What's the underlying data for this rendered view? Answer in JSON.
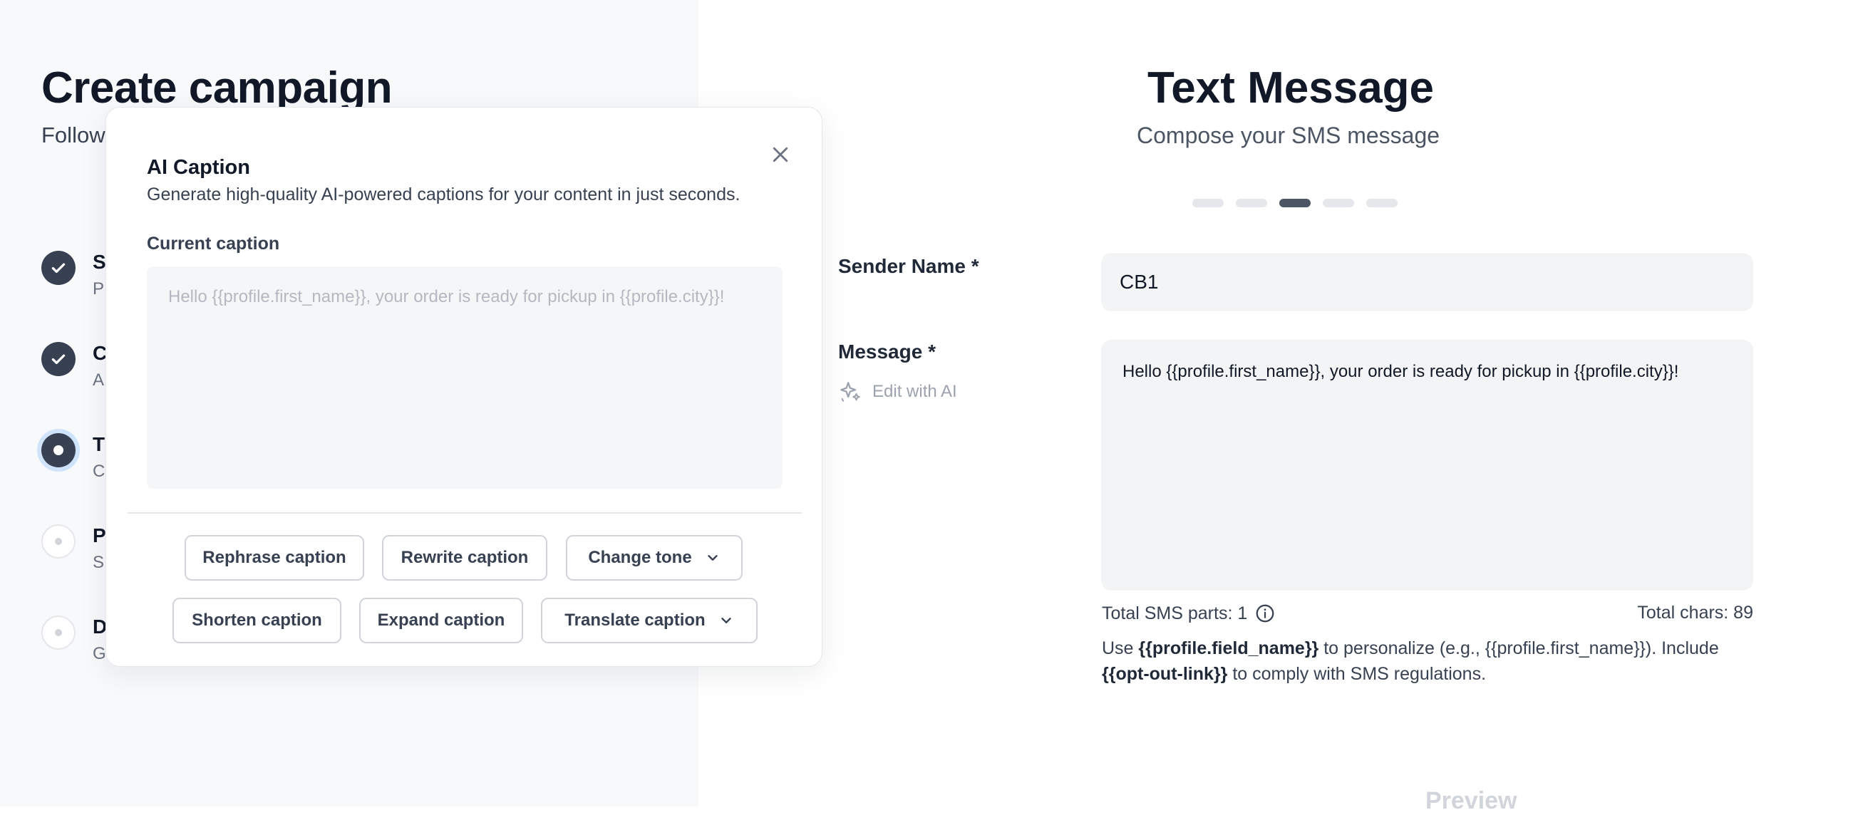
{
  "campaign": {
    "title": "Create campaign",
    "subtitle": "Follow",
    "steps": [
      {
        "title": "S",
        "desc": "P",
        "state": "done"
      },
      {
        "title": "C",
        "desc": "A",
        "state": "done"
      },
      {
        "title": "T",
        "desc": "C",
        "state": "current"
      },
      {
        "title": "P",
        "desc": "S",
        "state": "upcoming"
      },
      {
        "title": "D",
        "desc": "G",
        "state": "upcoming"
      }
    ]
  },
  "message_panel": {
    "title": "Text Message",
    "subtitle": "Compose your SMS message",
    "progress": {
      "total_steps": 5,
      "current_step": 3
    },
    "sender_label": "Sender Name *",
    "sender_value": "CB1",
    "message_label": "Message *",
    "edit_ai_label": "Edit with AI",
    "message_value": "Hello {{profile.first_name}}, your order is ready for pickup in {{profile.city}}!",
    "sms_parts": "Total SMS parts: 1",
    "total_chars": "Total chars: 89",
    "help": {
      "use": "Use",
      "token1": "{{profile.field_name}}",
      "mid": "to personalize (e.g., {{profile.first_name}}). Include",
      "token2": "{{opt-out-link}}",
      "end": "to comply with SMS regulations."
    },
    "preview_label": "Preview"
  },
  "ai_modal": {
    "title": "AI Caption",
    "description": "Generate high-quality AI-powered captions for your content in just seconds.",
    "current_caption_label": "Current caption",
    "current_caption": "Hello {{profile.first_name}}, your order is ready for pickup in {{profile.city}}!",
    "buttons": {
      "rephrase": "Rephrase caption",
      "rewrite": "Rewrite caption",
      "change_tone": "Change tone",
      "shorten": "Shorten caption",
      "expand": "Expand caption",
      "translate": "Translate caption"
    }
  },
  "colors": {
    "accent_dark": "#374151",
    "current_ring": "#cfe3fb",
    "input_bg": "#f3f4f6"
  },
  "icons": [
    "check-icon",
    "close-icon",
    "sparkle-icon",
    "info-icon",
    "chevron-down-icon"
  ]
}
